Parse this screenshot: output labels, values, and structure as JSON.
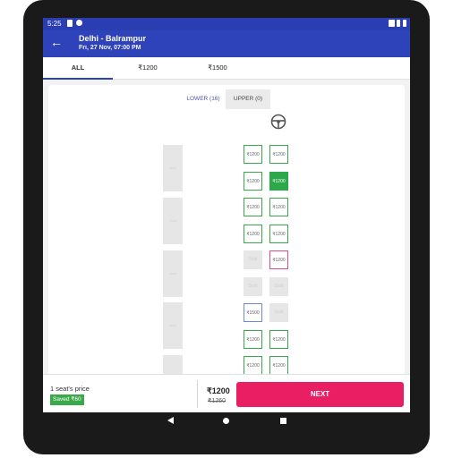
{
  "status": {
    "time": "5:25"
  },
  "appbar": {
    "title": "Delhi - Balrampur",
    "subtitle": "Fri, 27 Nov,  07:00 PM"
  },
  "tabs": [
    "ALL",
    "₹1200",
    "₹1500"
  ],
  "deck": {
    "lower": "LOWER (16)",
    "upper": "UPPER (0)"
  },
  "seat_labels": {
    "sold": "Sold"
  },
  "seats": [
    {
      "price": "₹1200",
      "state": "available"
    },
    {
      "price": "₹1200",
      "state": "available"
    },
    {
      "price": "₹1200",
      "state": "available"
    },
    {
      "price": "₹1200",
      "state": "selected"
    },
    {
      "price": "₹1200",
      "state": "available"
    },
    {
      "price": "₹1200",
      "state": "available"
    },
    {
      "price": "₹1200",
      "state": "available"
    },
    {
      "price": "₹1200",
      "state": "available"
    },
    {
      "price": "Sold",
      "state": "booked"
    },
    {
      "price": "₹1200",
      "state": "ladies"
    },
    {
      "price": "Sold",
      "state": "booked"
    },
    {
      "price": "Sold",
      "state": "booked"
    },
    {
      "price": "₹1500",
      "state": "other"
    },
    {
      "price": "Sold",
      "state": "booked"
    },
    {
      "price": "₹1200",
      "state": "available"
    },
    {
      "price": "₹1200",
      "state": "available"
    },
    {
      "price": "₹1200",
      "state": "available"
    },
    {
      "price": "₹1200",
      "state": "available"
    }
  ],
  "footer": {
    "caption": "1 seat's price",
    "saved": "Saved ₹60",
    "price": "₹1200",
    "old_price": "₹1260",
    "next_label": "NEXT"
  },
  "colors": {
    "primary": "#2e42b9",
    "accent": "#ea1f63",
    "available": "#3aa94a",
    "ladies": "#e84c7c"
  },
  "icons": [
    "back-arrow-icon",
    "steering-wheel-icon",
    "nav-back-icon",
    "nav-home-icon",
    "nav-recent-icon"
  ]
}
